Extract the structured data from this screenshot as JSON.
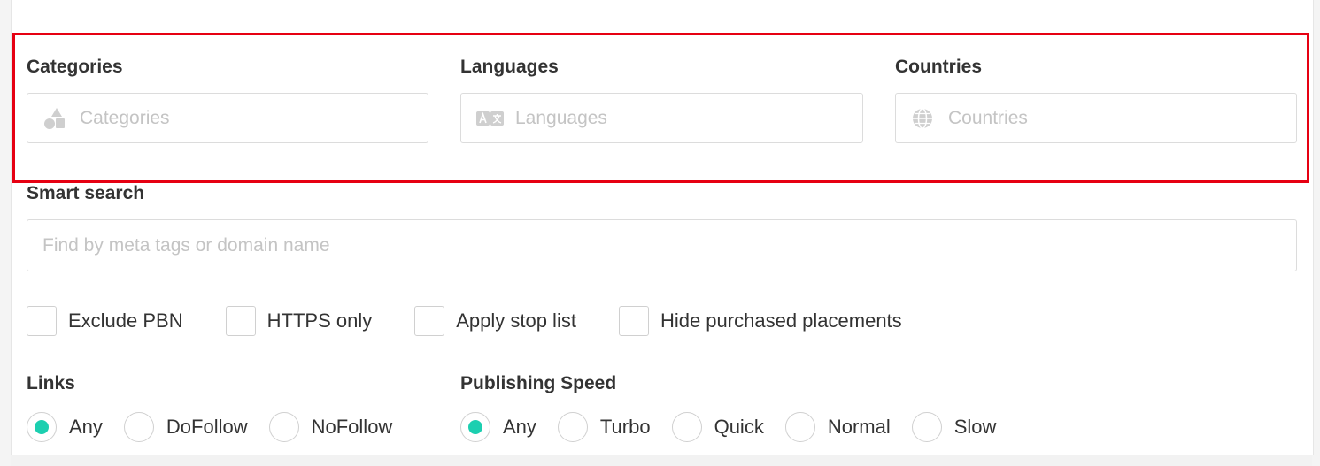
{
  "filters": {
    "categories": {
      "label": "Categories",
      "placeholder": "Categories",
      "icon": "shapes-icon"
    },
    "languages": {
      "label": "Languages",
      "placeholder": "Languages",
      "icon": "translate-icon"
    },
    "countries": {
      "label": "Countries",
      "placeholder": "Countries",
      "icon": "globe-icon"
    }
  },
  "smart_search": {
    "label": "Smart search",
    "placeholder": "Find by meta tags or domain name"
  },
  "checkboxes": [
    {
      "label": "Exclude PBN",
      "checked": false
    },
    {
      "label": "HTTPS only",
      "checked": false
    },
    {
      "label": "Apply stop list",
      "checked": false
    },
    {
      "label": "Hide purchased placements",
      "checked": false
    }
  ],
  "links": {
    "label": "Links",
    "options": [
      "Any",
      "DoFollow",
      "NoFollow"
    ],
    "selected": "Any"
  },
  "publishing_speed": {
    "label": "Publishing Speed",
    "options": [
      "Any",
      "Turbo",
      "Quick",
      "Normal",
      "Slow"
    ],
    "selected": "Any"
  },
  "colors": {
    "accent": "#1ccfb0",
    "highlight_border": "#e60012",
    "placeholder": "#c4c4c4",
    "icon": "#cfcfcf"
  }
}
